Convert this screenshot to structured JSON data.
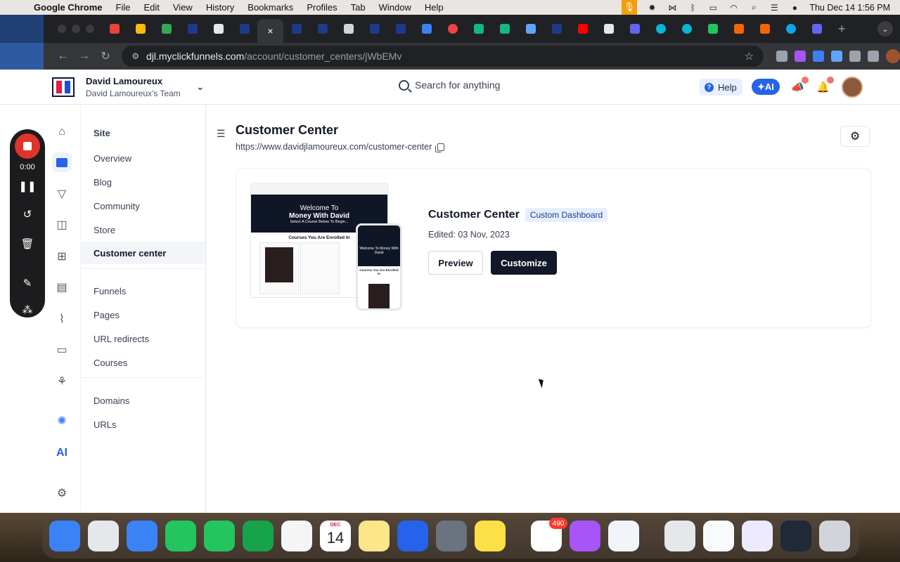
{
  "menubar": {
    "app_name": "Google Chrome",
    "items": [
      "File",
      "Edit",
      "View",
      "History",
      "Bookmarks",
      "Profiles",
      "Tab",
      "Window",
      "Help"
    ],
    "clock": "Thu Dec 14  1:56 PM"
  },
  "browser": {
    "url_host": "djl.myclickfunnels.com",
    "url_path": "/account/customer_centers/jWbEMv",
    "active_tab_close": "×"
  },
  "header": {
    "team_name": "David Lamoureux",
    "team_sub": "David Lamoureux's Team",
    "search_placeholder": "Search for anything",
    "help_label": "Help",
    "ai_label": "AI"
  },
  "sidebar": {
    "section_title": "Site",
    "items": [
      {
        "label": "Overview"
      },
      {
        "label": "Blog"
      },
      {
        "label": "Community"
      },
      {
        "label": "Store"
      },
      {
        "label": "Customer center",
        "active": true
      },
      {
        "label": "Funnels"
      },
      {
        "label": "Pages"
      },
      {
        "label": "URL redirects"
      },
      {
        "label": "Courses"
      },
      {
        "label": "Domains"
      },
      {
        "label": "URLs"
      }
    ]
  },
  "main": {
    "title": "Customer Center",
    "url": "https://www.davidjlamoureux.com/customer-center",
    "card": {
      "title": "Customer Center",
      "badge": "Custom Dashboard",
      "edited": "Edited: 03 Nov, 2023",
      "preview_label": "Preview",
      "customize_label": "Customize",
      "thumbnail": {
        "hero_line1": "Welcome To",
        "hero_line2": "Money With David",
        "hero_sub": "Select A Course Below To Begin...",
        "courses_label": "Courses You Are Enrolled In",
        "mobile_hero": "Welcome To Money With David",
        "mobile_courses": "Courses You Are Enrolled In"
      }
    }
  },
  "recorder": {
    "time": "0:00"
  },
  "dock": {
    "calendar_month": "DEC",
    "calendar_day": "14",
    "slack_badge": "490"
  },
  "colors": {
    "primary": "#2563eb",
    "dark_button": "#111827",
    "badge_bg": "#e6efff",
    "record_red": "#e0342b"
  }
}
